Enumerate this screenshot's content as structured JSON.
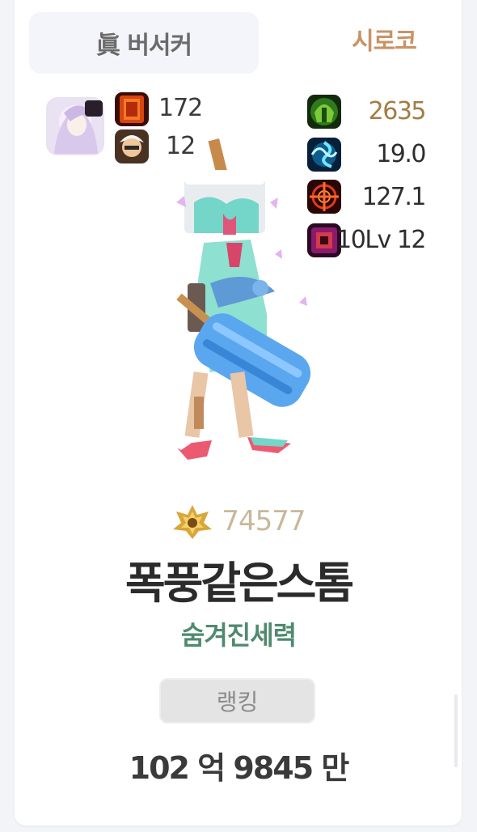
{
  "header": {
    "job_name": "眞 버서커",
    "server": "시로코"
  },
  "left_stats": {
    "top_value": "172",
    "bottom_value": "12"
  },
  "right_stats": [
    {
      "icon": "green-helmet-icon",
      "value": "2635",
      "color": "#a37c45"
    },
    {
      "icon": "blue-vortex-icon",
      "value": "19.0",
      "color": "#2e2e2e"
    },
    {
      "icon": "crosshair-icon",
      "value": "127.1",
      "color": "#2e2e2e"
    },
    {
      "icon": "crimson-box-icon",
      "value": "10Lv 12",
      "color": "#2e2e2e"
    }
  ],
  "character": {
    "fame": "74577",
    "name": "폭풍같은스톰",
    "guild": "숨겨진세력"
  },
  "ranking": {
    "button_label": "랭킹",
    "damage": "102 억 9845 만"
  }
}
